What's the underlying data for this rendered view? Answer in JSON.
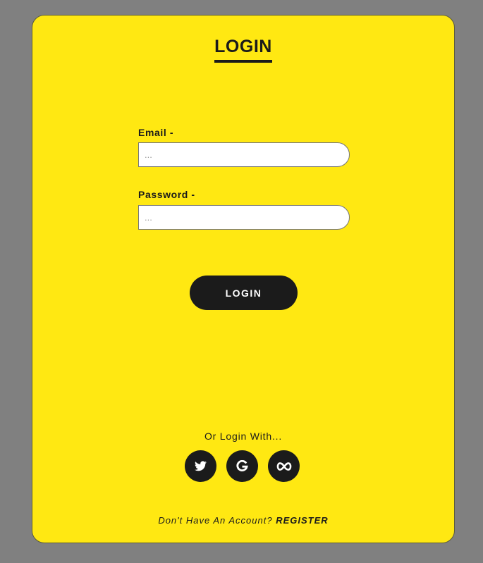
{
  "colors": {
    "page_background": "#808080",
    "card_background": "#ffe812",
    "dark": "#1b1b1b",
    "light": "#ffffff"
  },
  "form": {
    "title": "LOGIN",
    "email_label": "Email -",
    "email_placeholder": "...",
    "email_value": "",
    "password_label": "Password -",
    "password_placeholder": "...",
    "password_value": "",
    "submit_label": "LOGIN"
  },
  "social": {
    "heading": "Or Login With...",
    "providers": [
      {
        "name": "Twitter",
        "icon": "twitter-icon"
      },
      {
        "name": "Google",
        "icon": "google-icon"
      },
      {
        "name": "Meta",
        "icon": "meta-icon"
      }
    ]
  },
  "footer": {
    "prompt": "Don't Have An Account?",
    "register_label": "REGISTER"
  }
}
